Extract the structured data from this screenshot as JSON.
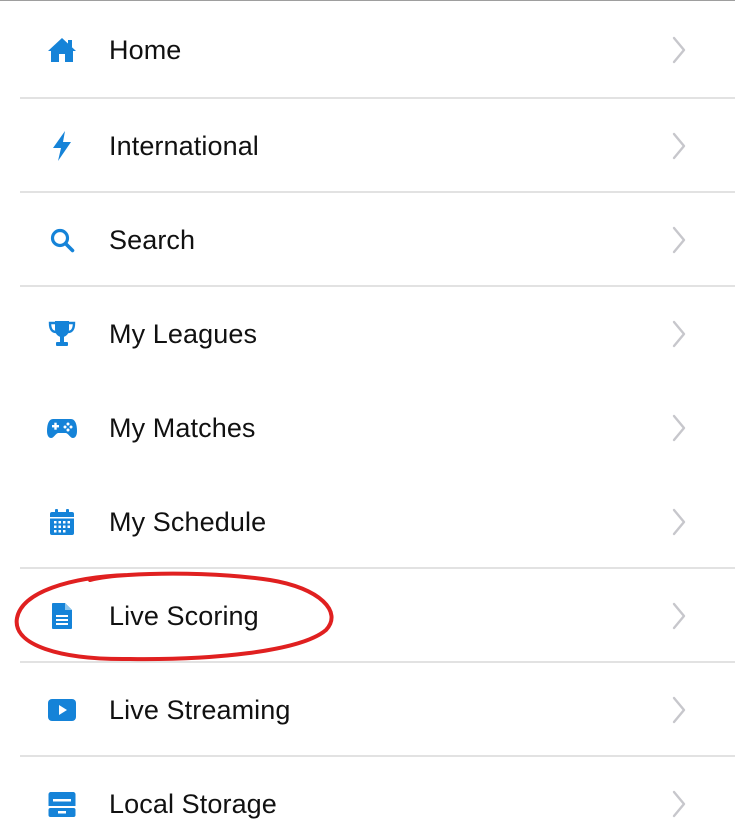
{
  "theme": {
    "accent": "#1583d8",
    "divider": "#e2e2e2",
    "chevron": "#c7c7cc",
    "annotation": "#e02020"
  },
  "menu": {
    "items": [
      {
        "label": "Home",
        "icon": "home-icon"
      },
      {
        "label": "International",
        "icon": "lightning-bolt-icon"
      },
      {
        "label": "Search",
        "icon": "search-icon"
      },
      {
        "label": "My Leagues",
        "icon": "trophy-icon"
      },
      {
        "label": "My Matches",
        "icon": "gamepad-icon"
      },
      {
        "label": "My Schedule",
        "icon": "calendar-icon"
      },
      {
        "label": "Live Scoring",
        "icon": "document-icon"
      },
      {
        "label": "Live Streaming",
        "icon": "play-button-icon"
      },
      {
        "label": "Local Storage",
        "icon": "storage-icon"
      }
    ]
  }
}
